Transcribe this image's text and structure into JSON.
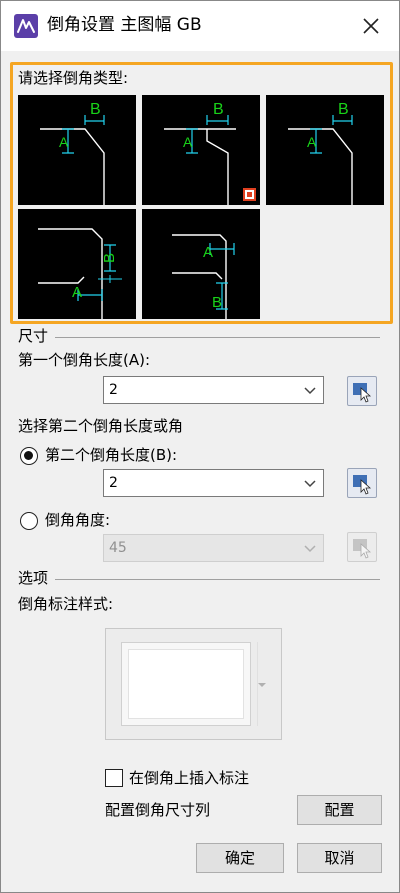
{
  "window": {
    "title": "倒角设置 主图幅 GB",
    "icon": "app-logo-icon",
    "close_icon": "close-icon"
  },
  "type_section": {
    "label": "请选择倒角类型:",
    "thumbnails": [
      {
        "id": "type-1",
        "labels": [
          "B",
          "A"
        ]
      },
      {
        "id": "type-2",
        "labels": [
          "B",
          "A"
        ],
        "selected_marker": true
      },
      {
        "id": "type-3",
        "labels": [
          "B",
          "A"
        ]
      },
      {
        "id": "type-4",
        "labels": [
          "B",
          "A"
        ]
      },
      {
        "id": "type-5",
        "labels": [
          "A",
          "B"
        ]
      }
    ]
  },
  "size_section": {
    "label": "尺寸",
    "first_length": {
      "label": "第一个倒角长度(A):",
      "value": "2"
    },
    "second_choice_label": "选择第二个倒角长度或角",
    "second_length": {
      "label": "第二个倒角长度(B):",
      "value": "2",
      "selected": true
    },
    "angle": {
      "label": "倒角角度:",
      "value": "45",
      "selected": false,
      "disabled": true
    }
  },
  "options_section": {
    "label": "选项",
    "style_label": "倒角标注样式:",
    "insert_dim": {
      "label": "在倒角上插入标注",
      "checked": false
    },
    "configure": {
      "label": "配置倒角尺寸列",
      "button": "配置"
    }
  },
  "footer": {
    "ok": "确定",
    "cancel": "取消"
  },
  "colors": {
    "accent_frame": "#f5a623",
    "drawing_green": "#19d219",
    "drawing_cyan": "#22d3ee",
    "drawing_white": "#ffffff"
  }
}
